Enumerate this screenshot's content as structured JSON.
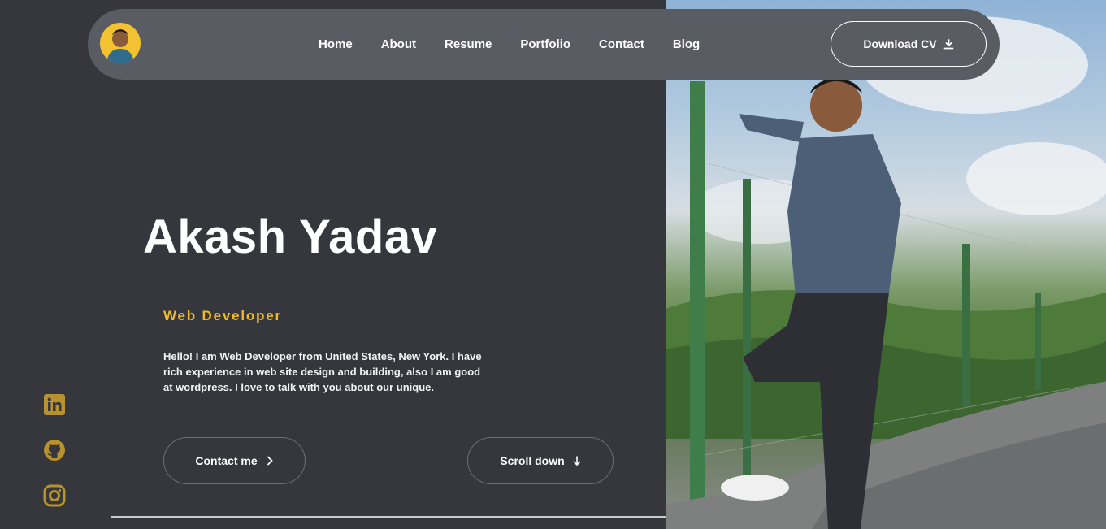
{
  "nav": {
    "items": [
      "Home",
      "About",
      "Resume",
      "Portfolio",
      "Contact",
      "Blog"
    ],
    "download_label": "Download CV"
  },
  "hero": {
    "name": "Akash Yadav",
    "role": "Web Developer",
    "bio": "Hello! I am Web Developer from United States, New York. I have rich experience in web site design and building, also I am good at wordpress. I love to talk with you about our unique.",
    "contact_label": "Contact me",
    "scroll_label": "Scroll down"
  },
  "social": [
    "linkedin-icon",
    "github-icon",
    "instagram-icon"
  ],
  "colors": {
    "background": "#35373c",
    "navbar": "#5a5c64",
    "accent": "#f0b928",
    "avatar_bg": "#f2c230"
  }
}
